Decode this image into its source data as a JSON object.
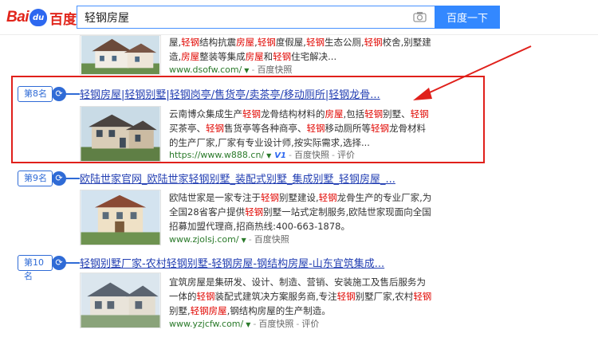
{
  "header": {
    "logo_bai": "Bai",
    "logo_du": "du",
    "logo_cn": "百度",
    "query": "轻钢房屋",
    "search_button": "百度一下"
  },
  "results": [
    {
      "desc_html": "屋,<em>轻钢</em>结构抗震<em>房屋</em>,<em>轻钢</em>度假屋,<em>轻钢</em>生态公厕,<em>轻钢</em>校舍,别墅建造,<em>房屋</em>整装等集成<em>房屋</em>和<em>轻钢</em>住宅解决...",
      "url": "www.dsofw.com/",
      "snapshot": "百度快照"
    },
    {
      "rank": "第8名",
      "title": "轻钢房屋|轻钢别墅|轻钢岗亭/售货亭/卖茶亭/移动厕所|轻钢龙骨...",
      "desc_html": "云南博众集成生产<em>轻钢</em>龙骨结构材料的<em>房屋</em>,包括<em>轻钢</em>别墅、<em>轻钢</em>买茶亭、<em>轻钢</em>售货亭等各种商亭、<em>轻钢</em>移动厕所等<em>轻钢</em>龙骨材料的生产厂家,厂家有专业设计师,按实际需求,选择...",
      "url": "https://www.w888.cn/",
      "v_badge": "V1",
      "snapshot": "百度快照",
      "rating": "评价"
    },
    {
      "rank": "第9名",
      "title": "欧陆世家官网_欧陆世家轻钢别墅_装配式别墅_集成别墅_轻钢房屋_...",
      "desc_html": "欧陆世家是一家专注于<em>轻钢</em>别墅建设,<em>轻钢</em>龙骨生产的专业厂家,为全国28省客户提供<em>轻钢</em>别墅一站式定制服务,欧陆世家现面向全国招募加盟代理商,招商热线:400-663-1878。",
      "url": "www.zjolsj.com/",
      "snapshot": "百度快照"
    },
    {
      "rank": "第10名",
      "title": "轻钢别墅厂家-农村轻钢别墅-轻钢房屋-钢结构房屋-山东宜筑集成...",
      "desc_html": "宜筑房屋是集研发、设计、制造、营销、安装施工及售后服务为一体的<em>轻钢</em>装配式建筑决方案服务商,专注<em>轻钢</em>别墅厂家,农村<em>轻钢</em>别墅,<em>轻钢房屋</em>,钢结构房屋的生产制造。",
      "url": "www.yzjcfw.com/",
      "snapshot": "百度快照",
      "rating": "评价"
    }
  ],
  "colors": {
    "brand_blue": "#3388ff",
    "title_link": "#2440b3",
    "keyword_red": "#e10601",
    "highlight_red": "#e0201b"
  }
}
